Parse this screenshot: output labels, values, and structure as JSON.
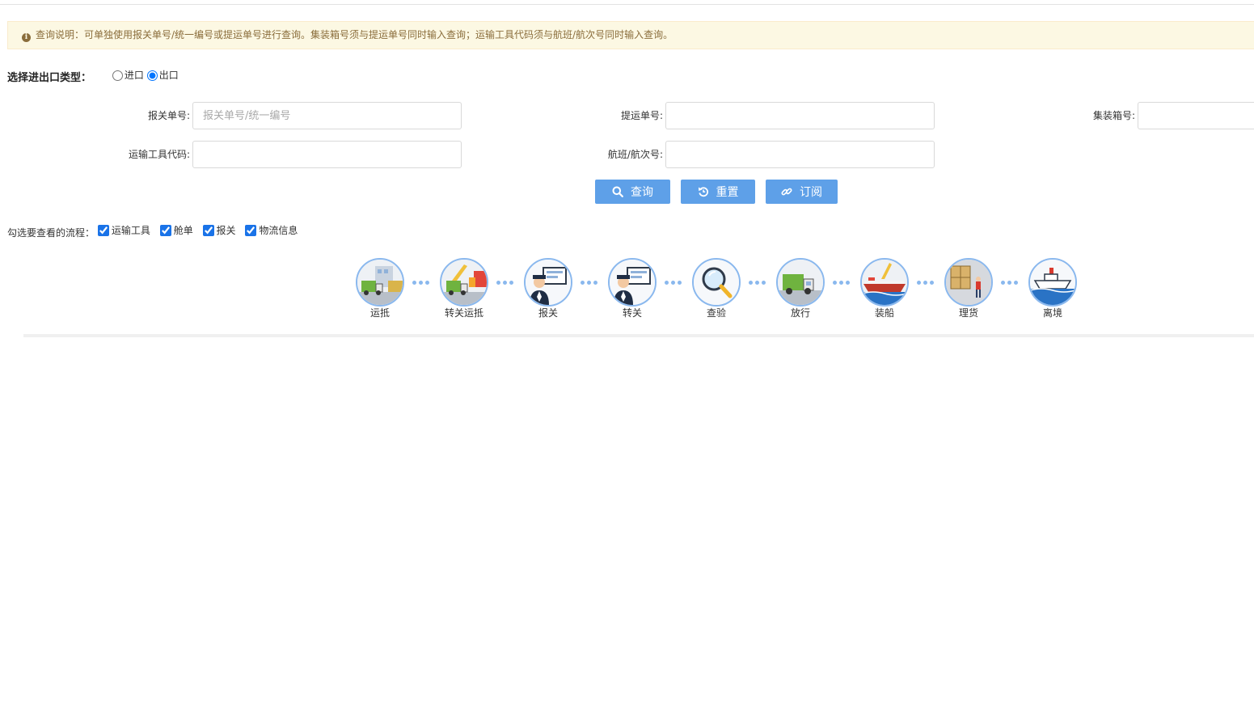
{
  "notice": {
    "icon": "info-circle-icon",
    "text": "查询说明：可单独使用报关单号/统一编号或提运单号进行查询。集装箱号须与提运单号同时输入查询；运输工具代码须与航班/航次号同时输入查询。"
  },
  "io_type": {
    "label": "选择进出口类型：",
    "options": [
      {
        "label": "进口",
        "checked": false
      },
      {
        "label": "出口",
        "checked": true
      }
    ]
  },
  "form": {
    "declaration_no": {
      "label": "报关单号:",
      "placeholder": "报关单号/统一编号",
      "value": ""
    },
    "bill_no": {
      "label": "提运单号:",
      "value": ""
    },
    "container_no": {
      "label": "集装箱号:",
      "value": ""
    },
    "transport_code": {
      "label": "运输工具代码:",
      "value": ""
    },
    "voyage_no": {
      "label": "航班/航次号:",
      "value": ""
    }
  },
  "buttons": {
    "query": {
      "label": "查询",
      "icon": "search-icon"
    },
    "reset": {
      "label": "重置",
      "icon": "undo-icon"
    },
    "subscribe": {
      "label": "订阅",
      "icon": "link-icon"
    }
  },
  "flow_filter": {
    "label": "勾选要查看的流程：",
    "options": [
      {
        "label": "运输工具",
        "checked": true
      },
      {
        "label": "舱单",
        "checked": true
      },
      {
        "label": "报关",
        "checked": true
      },
      {
        "label": "物流信息",
        "checked": true
      }
    ]
  },
  "steps": [
    {
      "label": "运抵",
      "icon": "truck-arrival-icon"
    },
    {
      "label": "转关运抵",
      "icon": "truck-crane-icon"
    },
    {
      "label": "报关",
      "icon": "customs-officer-icon"
    },
    {
      "label": "转关",
      "icon": "customs-officer-icon"
    },
    {
      "label": "查验",
      "icon": "magnifier-icon"
    },
    {
      "label": "放行",
      "icon": "truck-icon"
    },
    {
      "label": "装船",
      "icon": "ship-loading-icon"
    },
    {
      "label": "理货",
      "icon": "cargo-worker-icon"
    },
    {
      "label": "离境",
      "icon": "ship-departure-icon"
    }
  ],
  "colors": {
    "primary_button": "#5ea0e8",
    "notice_bg": "#fcf8e3",
    "notice_text": "#8a6d3b",
    "step_border": "#8ab8ee"
  }
}
